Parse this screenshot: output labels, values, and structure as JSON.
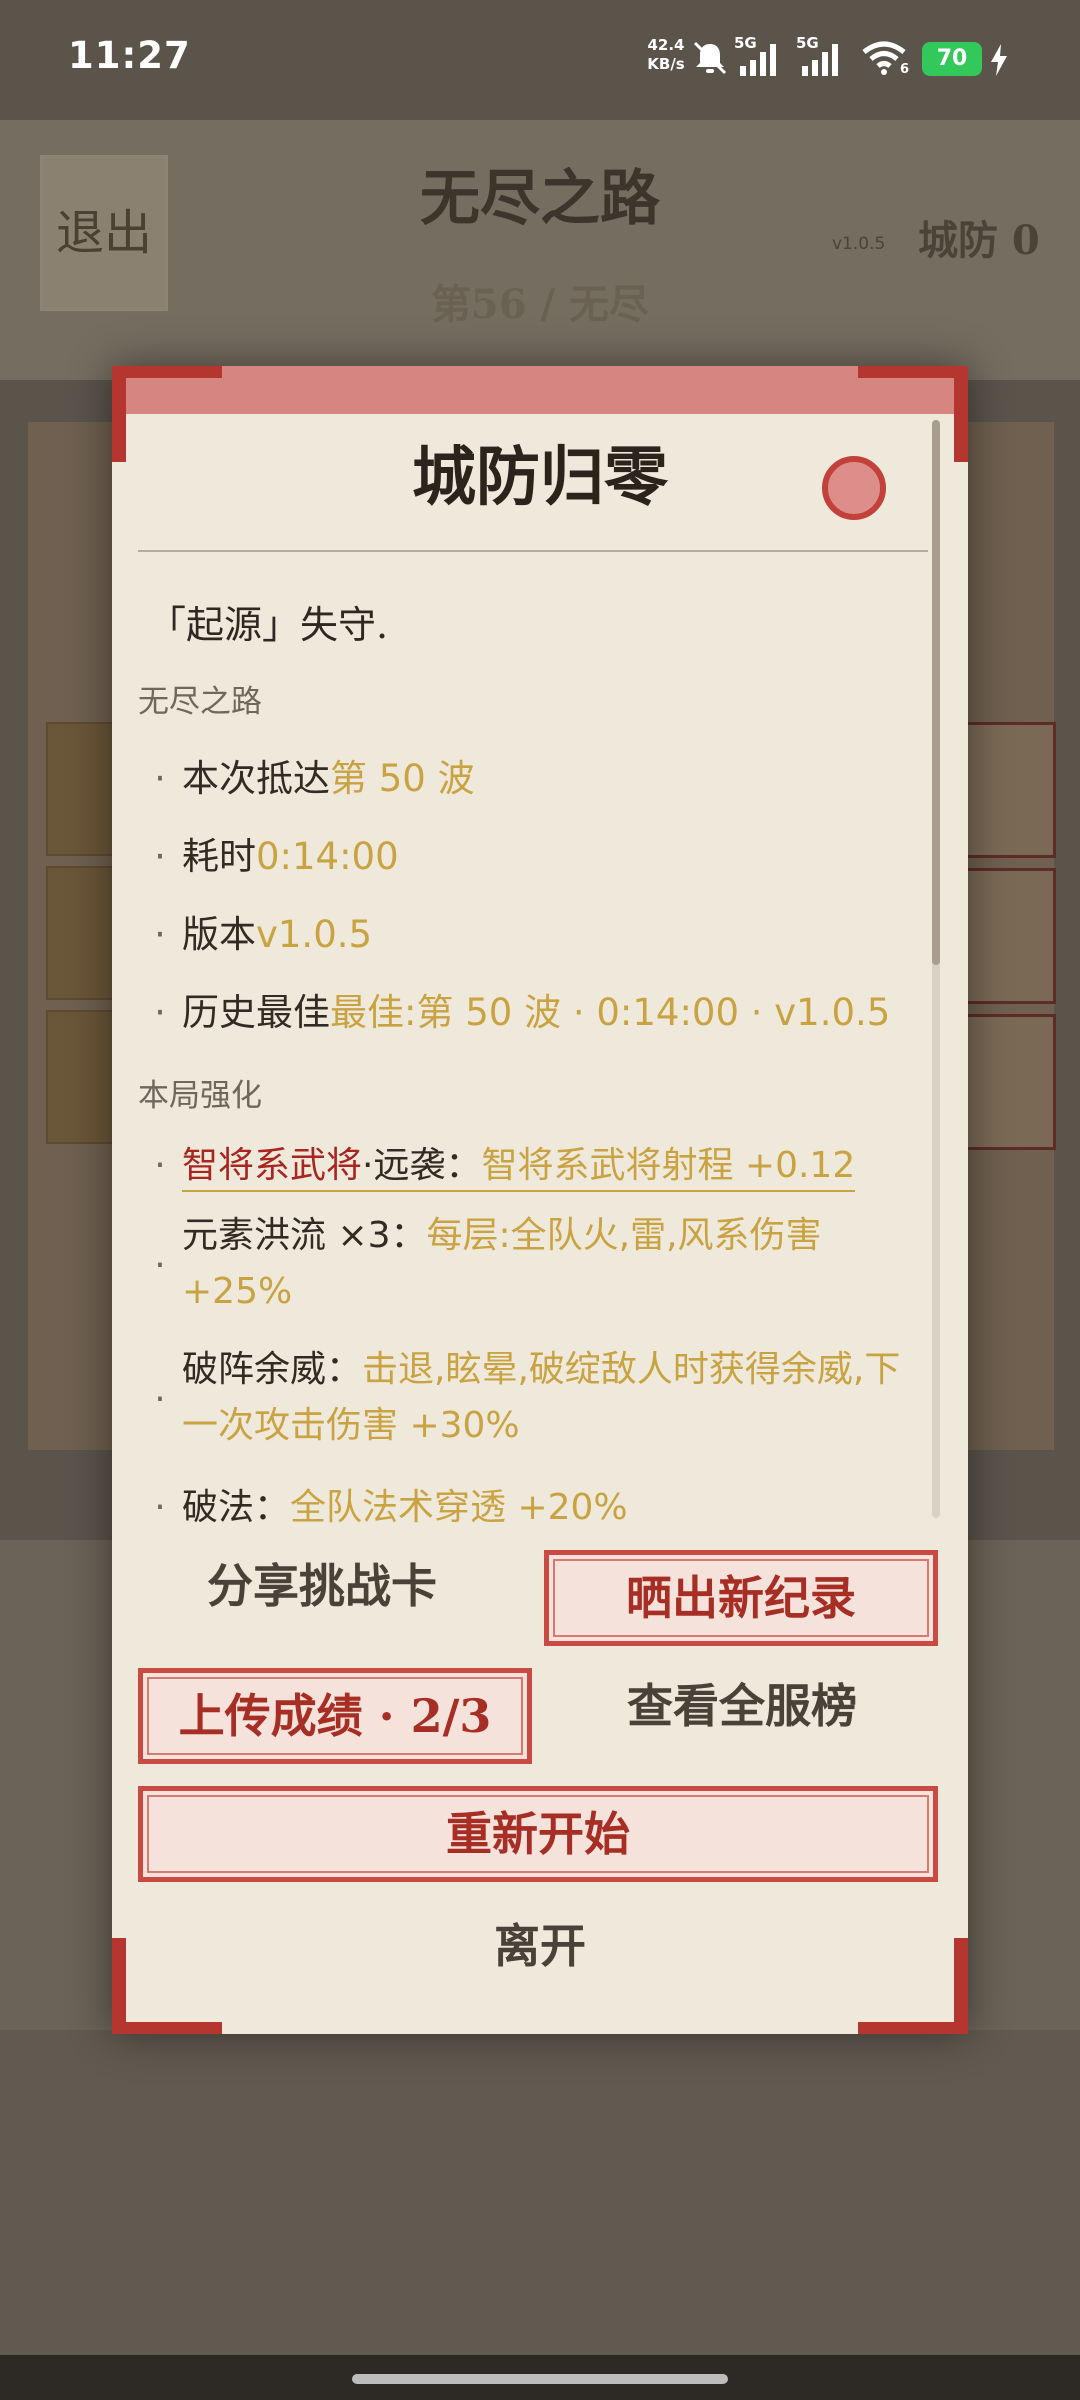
{
  "status_bar": {
    "time": "11:27",
    "net_speed_value": "42.4",
    "net_speed_unit": "KB/s",
    "sim1": "5G",
    "sim2": "5G",
    "wifi_badge": "6",
    "battery": "70"
  },
  "background": {
    "exit_label": "退出",
    "title": "无尽之路",
    "version": "v1.0.5",
    "defense": "城防 0",
    "wave": "第56 / 无尽"
  },
  "dialog": {
    "title": "城防归零",
    "intro": "「起源」失守.",
    "section_run": "无尽之路",
    "run_stats": [
      {
        "label": "本次抵达",
        "value": "第 50 波"
      },
      {
        "label": "耗时",
        "value": "0:14:00"
      },
      {
        "label": "版本",
        "value": "v1.0.5"
      },
      {
        "label": "历史最佳",
        "value": "最佳:第 50 波 · 0:14:00 · v1.0.5"
      }
    ],
    "section_buffs": "本局强化",
    "buffs": [
      {
        "name_red": "智将系武将",
        "name_rest": "·远袭：",
        "desc": "智将系武将射程 +0.12"
      },
      {
        "name_rest": "元素洪流 ×3：",
        "desc": "每层:全队火,雷,风系伤害 +25%"
      },
      {
        "name_rest": "破阵余威：",
        "desc": "击退,眩晕,破绽敌人时获得余威,下一次攻击伤害 +30%"
      },
      {
        "name_rest": "破法：",
        "desc": "全队法术穿透 +20%"
      }
    ],
    "buttons": {
      "share": "分享挑战卡",
      "brag": "晒出新纪录",
      "upload": "上传成绩 · 2/3",
      "leaderboard": "查看全服榜",
      "restart": "重新开始",
      "leave": "离开"
    }
  },
  "colors": {
    "accent_red": "#a8261f",
    "accent_gold": "#c9a242",
    "panel": "#efe9dc"
  }
}
